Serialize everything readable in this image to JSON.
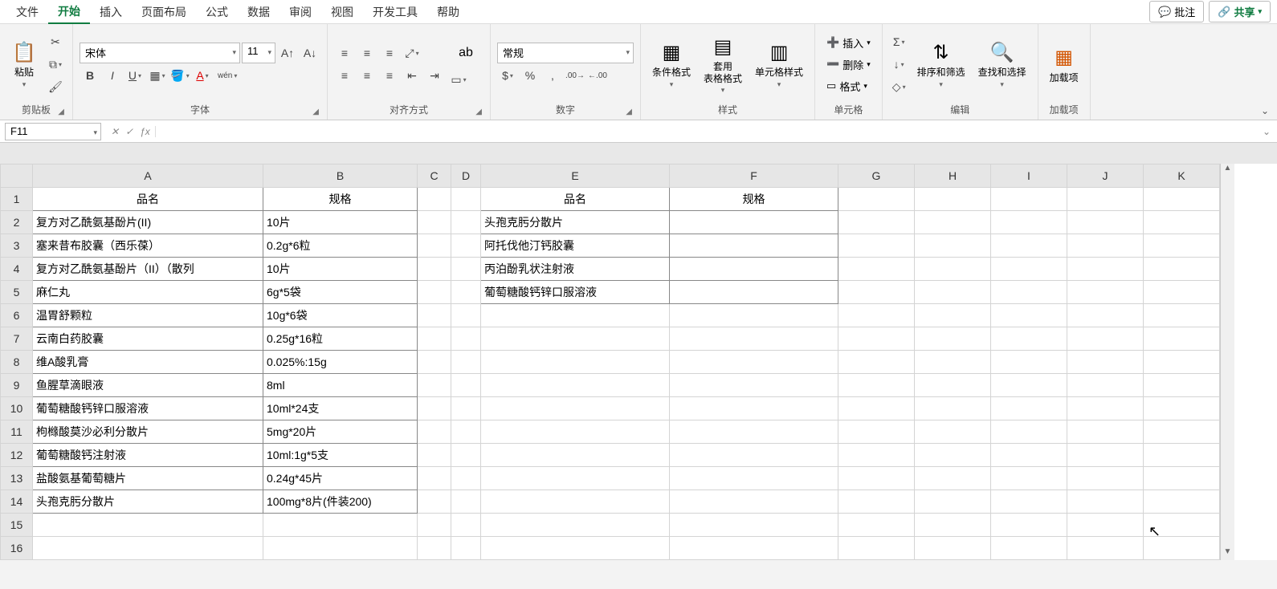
{
  "menu": {
    "items": [
      "文件",
      "开始",
      "插入",
      "页面布局",
      "公式",
      "数据",
      "审阅",
      "视图",
      "开发工具",
      "帮助"
    ],
    "active_index": 1,
    "comment_btn": "批注",
    "share_btn": "共享"
  },
  "ribbon": {
    "clipboard": {
      "paste": "粘贴",
      "label": "剪贴板"
    },
    "font": {
      "name": "宋体",
      "size": "11",
      "label": "字体"
    },
    "alignment": {
      "wrap": "ab",
      "label": "对齐方式"
    },
    "number": {
      "format": "常规",
      "label": "数字"
    },
    "styles": {
      "cond_fmt": "条件格式",
      "table_fmt": "套用\n表格格式",
      "cell_styles": "单元格样式",
      "label": "样式"
    },
    "cells": {
      "insert": "插入",
      "delete": "删除",
      "format": "格式",
      "label": "单元格"
    },
    "editing": {
      "sort_filter": "排序和筛选",
      "find_select": "查找和选择",
      "label": "编辑"
    },
    "addins": {
      "addins": "加载项",
      "label": "加载项"
    }
  },
  "formula_bar": {
    "name_box": "F11",
    "formula": ""
  },
  "grid": {
    "columns": [
      "A",
      "B",
      "C",
      "D",
      "E",
      "F",
      "G",
      "H",
      "I",
      "J",
      "K"
    ],
    "row_count": 16,
    "headers_left": {
      "A": "品名",
      "B": "规格"
    },
    "headers_right": {
      "E": "品名",
      "F": "规格"
    },
    "left_table": [
      {
        "name": "复方对乙酰氨基酚片(II)",
        "spec": "10片"
      },
      {
        "name": "塞来昔布胶囊（西乐葆）",
        "spec": "0.2g*6粒"
      },
      {
        "name": "复方对乙酰氨基酚片（II）（散列",
        "spec": "10片"
      },
      {
        "name": "麻仁丸",
        "spec": "6g*5袋"
      },
      {
        "name": "温胃舒颗粒",
        "spec": "10g*6袋"
      },
      {
        "name": "云南白药胶囊",
        "spec": "0.25g*16粒"
      },
      {
        "name": "维A酸乳膏",
        "spec": "0.025%:15g"
      },
      {
        "name": "鱼腥草滴眼液",
        "spec": "8ml"
      },
      {
        "name": "葡萄糖酸钙锌口服溶液",
        "spec": "10ml*24支"
      },
      {
        "name": "枸橼酸莫沙必利分散片",
        "spec": "5mg*20片"
      },
      {
        "name": "葡萄糖酸钙注射液",
        "spec": "10ml:1g*5支"
      },
      {
        "name": "盐酸氨基葡萄糖片",
        "spec": "0.24g*45片"
      },
      {
        "name": "头孢克肟分散片",
        "spec": "100mg*8片(件装200)"
      }
    ],
    "right_table": [
      {
        "name": "头孢克肟分散片",
        "spec": ""
      },
      {
        "name": "阿托伐他汀钙胶囊",
        "spec": ""
      },
      {
        "name": "丙泊酚乳状注射液",
        "spec": ""
      },
      {
        "name": "葡萄糖酸钙锌口服溶液",
        "spec": ""
      }
    ]
  }
}
